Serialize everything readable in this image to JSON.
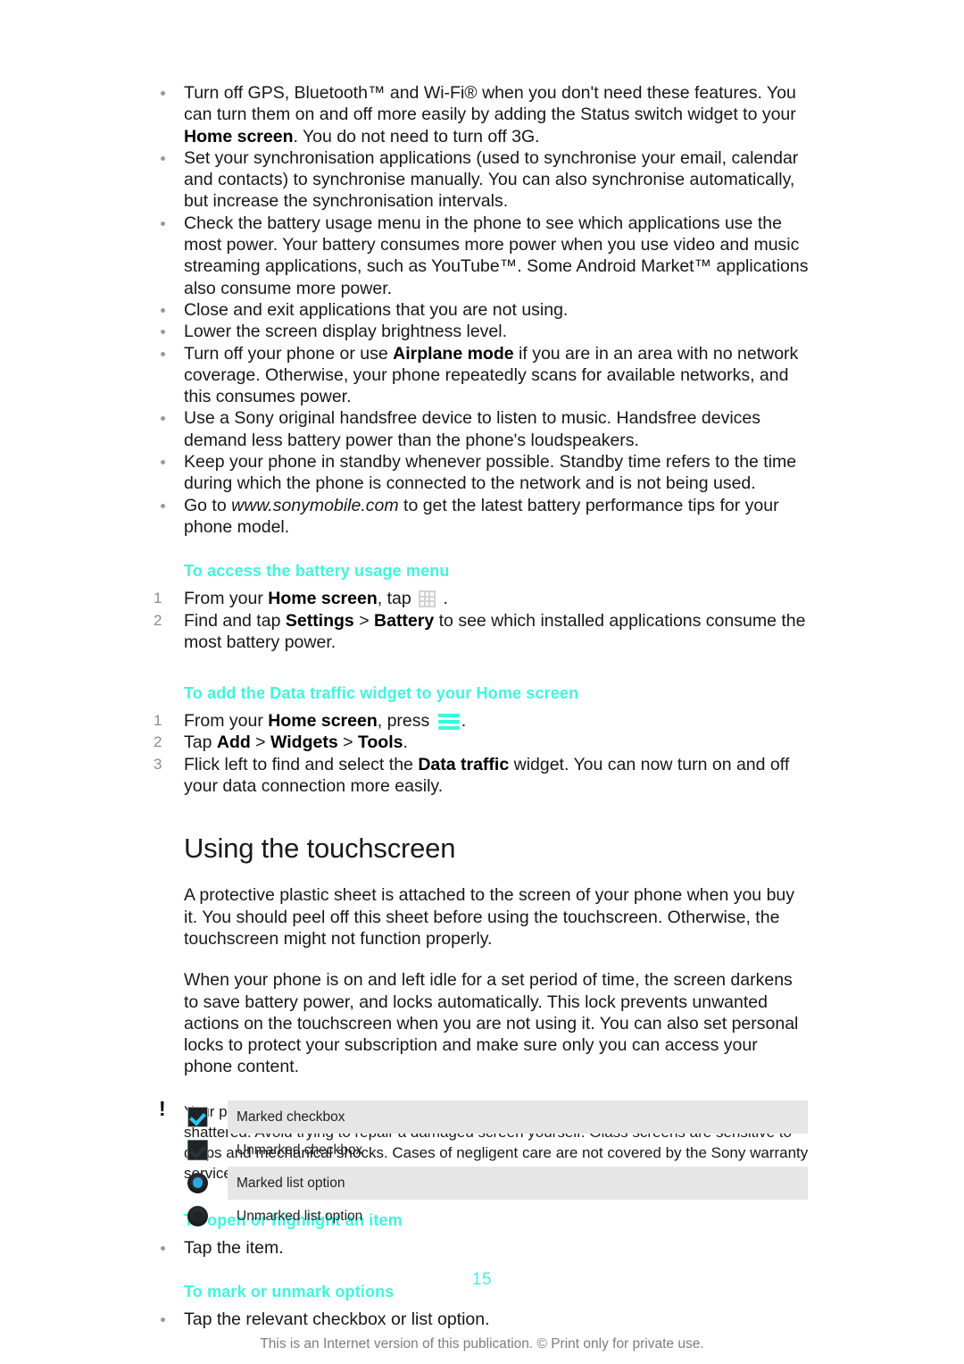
{
  "document": {
    "page_number": "15",
    "footer_note": "This is an Internet version of this publication. © Print only for private use.",
    "accent_color": "#3FF5DC",
    "checkbox_accent": "#2FC7EF",
    "radio_accent": "#2FA8E0"
  },
  "battery_tips": {
    "bullets": [
      "Turn off GPS, Bluetooth™ and Wi-Fi® when you don't need these features. You can turn them on and off more easily by adding the Status switch widget to your <b>Home screen</b>. You do not need to turn off 3G.",
      "Set your synchronisation applications (used to synchronise your email, calendar and contacts) to synchronise manually. You can also synchronise automatically, but increase the synchronisation intervals.",
      "Check the battery usage menu in the phone to see which applications use the most power. Your battery consumes more power when you use video and music streaming applications, such as YouTube™. Some Android Market™ applications also consume more power.",
      "Close and exit applications that you are not using.",
      "Lower the screen display brightness level.",
      "Turn off your phone or use <b>Airplane mode</b> if you are in an area with no network coverage. Otherwise, your phone repeatedly scans for available networks, and this consumes power.",
      "Use a Sony original handsfree device to listen to music. Handsfree devices demand less battery power than the phone's loudspeakers.",
      "Keep your phone in standby whenever possible. Standby time refers to the time during which the phone is connected to the network and is not being used.",
      "Go to <i>www.sonymobile.com</i> to get the latest battery performance tips for your phone model."
    ]
  },
  "battery_usage_menu": {
    "heading": "To access the battery usage menu",
    "steps": [
      {
        "num": "1",
        "html": "From your <b>Home screen</b>, tap <span class=\"icon-grid\" data-name=\"app-drawer-icon\" data-interactable=\"false\"><i class=\"v\" style=\"left:0\"></i><i class=\"v\" style=\"left:5.6px\"></i><i class=\"v\" style=\"left:11.2px\"></i><i class=\"v\" style=\"left:17px\"></i><i class=\"h\" style=\"top:0\"></i><i class=\"h\" style=\"top:5.6px\"></i><i class=\"h\" style=\"top:11.2px\"></i><i class=\"h\" style=\"top:17px\"></i></span> ."
      },
      {
        "num": "2",
        "html": "Find and tap <b>Settings</b> > <b>Battery</b> to see which installed applications consume the most battery power."
      }
    ]
  },
  "data_traffic_widget": {
    "heading": "To add the Data traffic widget to your Home screen",
    "steps": [
      {
        "num": "1",
        "html": "From your <b>Home screen</b>, press <span class=\"icon-menu\" data-name=\"menu-icon\" data-interactable=\"false\"><i style=\"top:1px\"></i><i style=\"top:8px\"></i><i style=\"top:15px\"></i></span>."
      },
      {
        "num": "2",
        "html": "Tap <b>Add</b> > <b>Widgets</b> > <b>Tools</b>."
      },
      {
        "num": "3",
        "html": "Flick left to find and select the <b>Data traffic</b> widget. You can now turn on and off your data connection more easily."
      }
    ]
  },
  "touchscreen": {
    "title": "Using the touchscreen",
    "paragraph_1": "A protective plastic sheet is attached to the screen of your phone when you buy it. You should peel off this sheet before using the touchscreen. Otherwise, the touchscreen might not function properly.",
    "paragraph_2": "When your phone is on and left idle for a set period of time, the screen darkens to save battery power, and locks automatically. This lock prevents unwanted actions on the touchscreen when you are not using it. You can also set personal locks to protect your subscription and make sure only you can access your phone content.",
    "note": "Your phone screen is made from glass. Do not touch the screen if the glass is cracked or shattered. Avoid trying to repair a damaged screen yourself. Glass screens are sensitive to drops and mechanical shocks. Cases of negligent care are not covered by the Sony warranty service."
  },
  "open_highlight": {
    "heading": "To open or highlight an item",
    "bullets": [
      "Tap the item."
    ]
  },
  "mark_unmark": {
    "heading": "To mark or unmark options",
    "bullets": [
      "Tap the relevant checkbox or list option."
    ],
    "options_table": [
      {
        "glyph": "marked-checkbox",
        "label": "Marked checkbox",
        "shaded": true
      },
      {
        "glyph": "unmarked-checkbox",
        "label": "Unmarked checkbox",
        "shaded": false
      },
      {
        "glyph": "marked-list-option",
        "label": "Marked list option",
        "shaded": true
      },
      {
        "glyph": "unmarked-list-option",
        "label": "Unmarked list option",
        "shaded": false
      }
    ]
  }
}
